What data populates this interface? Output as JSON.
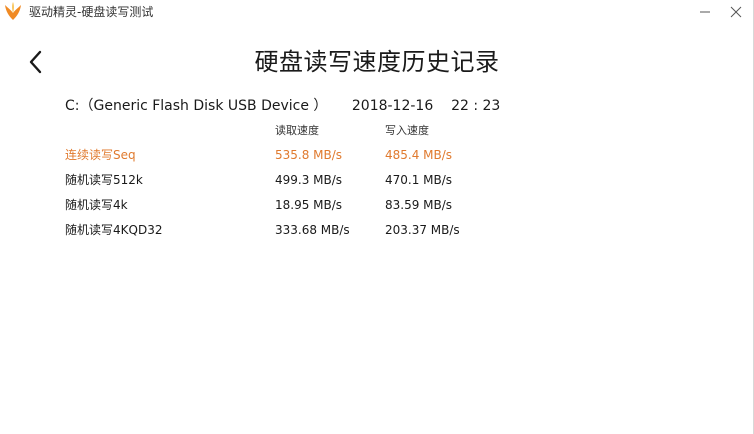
{
  "window": {
    "title": "驱动精灵-硬盘读写测试",
    "logo_icon": "app-logo-icon",
    "minimize_icon": "minimize-icon",
    "close_icon": "close-icon"
  },
  "page": {
    "back_icon": "chevron-left-icon",
    "title": "硬盘读写速度历史记录"
  },
  "device": {
    "name": "C:（Generic Flash Disk USB Device ）",
    "date": "2018-12-16",
    "time": "22 : 23"
  },
  "table": {
    "headers": {
      "read": "读取速度",
      "write": "写入速度"
    },
    "rows": [
      {
        "label": "连续读写Seq",
        "read": "535.8 MB/s",
        "write": "485.4 MB/s",
        "highlight": true
      },
      {
        "label": "随机读写512k",
        "read": "499.3 MB/s",
        "write": "470.1 MB/s",
        "highlight": false
      },
      {
        "label": "随机读写4k",
        "read": "18.95 MB/s",
        "write": "83.59 MB/s",
        "highlight": false
      },
      {
        "label": "随机读写4KQD32",
        "read": "333.68 MB/s",
        "write": "203.37 MB/s",
        "highlight": false
      }
    ]
  },
  "colors": {
    "highlight": "#e07a2e",
    "logo_orange": "#f08a24",
    "logo_yellow": "#f7b52c",
    "text": "#1a1a1a"
  }
}
